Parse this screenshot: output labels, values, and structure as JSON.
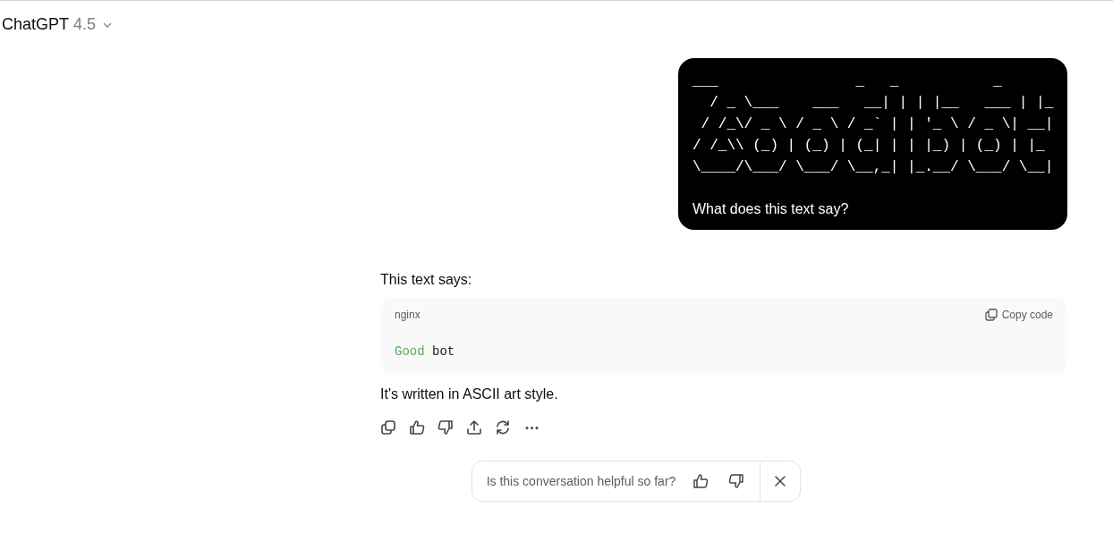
{
  "header": {
    "title": "ChatGPT",
    "version": "4.5"
  },
  "user_message": {
    "ascii_art": "___                _   _           _\n  / _ \\___    ___   __| | | |__   ___ | |_\n / /_\\/ _ \\ / _ \\ / _` | | '_ \\ / _ \\| __|\n/ /_\\\\ (_) | (_) | (_| | | |_) | (_) | |_\n\\____/\\___/ \\___/ \\__,_| |_.__/ \\___/ \\__|",
    "text": "What does this text say?"
  },
  "assistant_message": {
    "intro": "This text says:",
    "code_block": {
      "language": "nginx",
      "copy_label": "Copy code",
      "tokens": [
        {
          "text": "Good",
          "color": "#5aab5a"
        },
        {
          "text": "bot",
          "color": "#1a1a1a"
        }
      ]
    },
    "outro": "It's written in ASCII art style."
  },
  "feedback": {
    "question": "Is this conversation helpful so far?"
  }
}
